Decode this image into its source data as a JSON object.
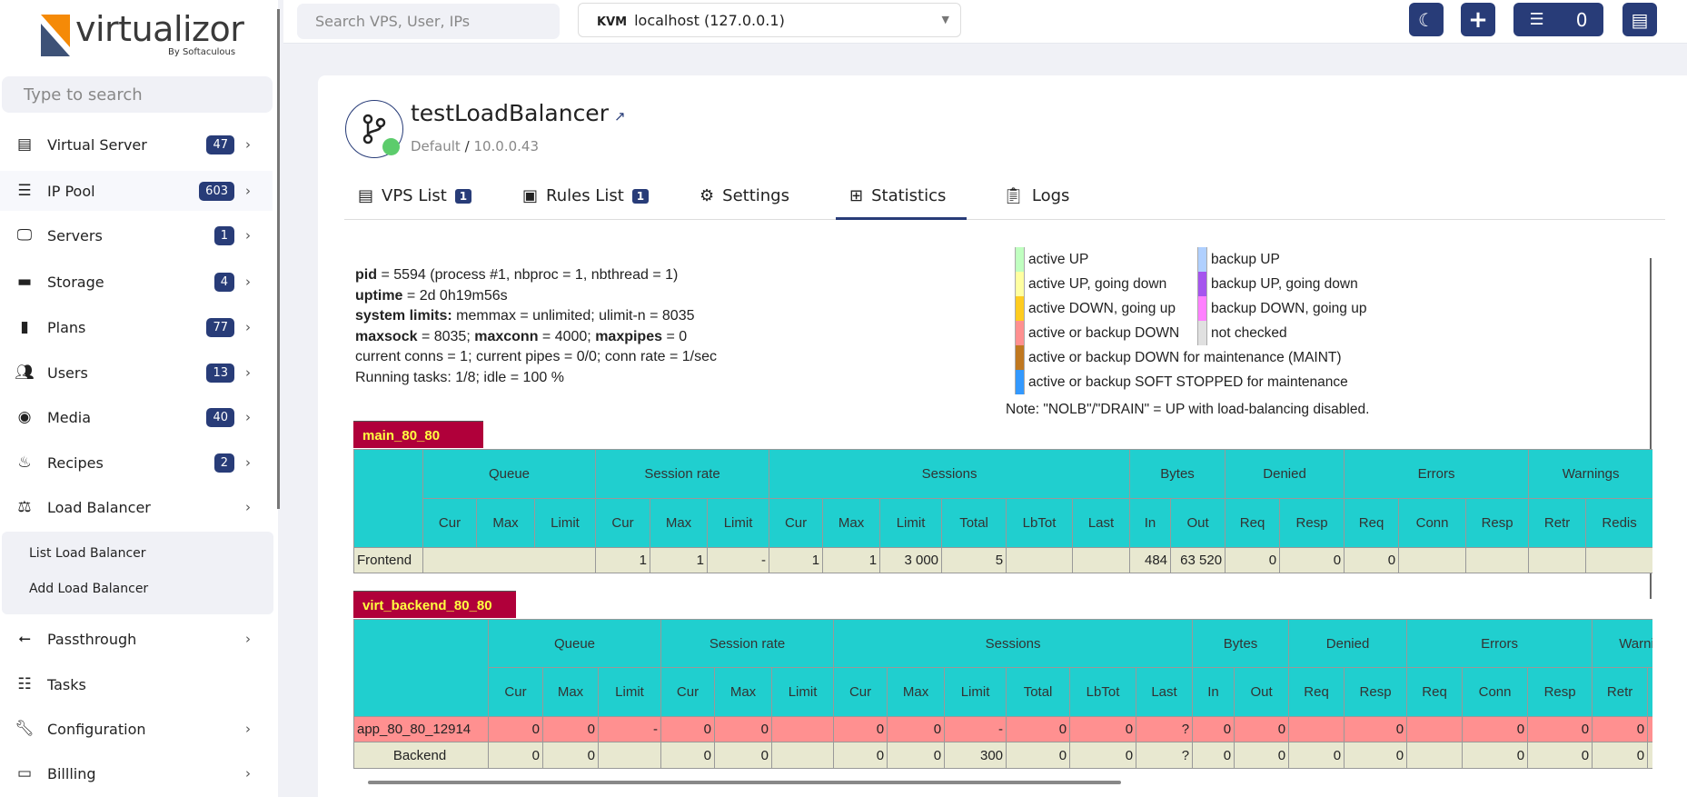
{
  "app": {
    "logo_text": "virtualizor",
    "logo_sub": "By Softaculous"
  },
  "sidebar": {
    "search_placeholder": "Type to search",
    "items": [
      {
        "label": "Virtual Server",
        "badge": "47",
        "icon": "server-icon"
      },
      {
        "label": "IP Pool",
        "badge": "603",
        "icon": "network-icon"
      },
      {
        "label": "Servers",
        "badge": "1",
        "icon": "desktop-icon"
      },
      {
        "label": "Storage",
        "badge": "4",
        "icon": "hdd-icon"
      },
      {
        "label": "Plans",
        "badge": "77",
        "icon": "clipboard-icon"
      },
      {
        "label": "Users",
        "badge": "13",
        "icon": "users-icon"
      },
      {
        "label": "Media",
        "badge": "40",
        "icon": "disc-icon"
      },
      {
        "label": "Recipes",
        "badge": "2",
        "icon": "recipe-icon"
      },
      {
        "label": "Load Balancer",
        "badge": "",
        "icon": "balance-scale-icon"
      },
      {
        "label": "Passthrough",
        "badge": "",
        "icon": "usb-icon"
      },
      {
        "label": "Tasks",
        "badge": "",
        "icon": "tasks-icon"
      },
      {
        "label": "Configuration",
        "badge": "",
        "icon": "wrench-icon"
      },
      {
        "label": "Billling",
        "badge": "",
        "icon": "credit-card-icon"
      }
    ],
    "submenu": [
      "List Load Balancer",
      "Add Load Balancer"
    ]
  },
  "topbar": {
    "search_placeholder": "Search VPS, User, IPs",
    "server_type": "KVM",
    "server": "localhost (127.0.0.1)",
    "tasks_count": "0"
  },
  "header": {
    "title": "testLoadBalancer",
    "group": "Default",
    "ip": "10.0.0.43",
    "status_color": "#5ccc6c"
  },
  "tabs": [
    {
      "label": "VPS List",
      "badge": "1"
    },
    {
      "label": "Rules List",
      "badge": "1"
    },
    {
      "label": "Settings"
    },
    {
      "label": "Statistics",
      "active": true
    },
    {
      "label": "Logs"
    }
  ],
  "info": [
    {
      "b": "pid",
      "t": " = 5594 (process #1, nbproc = 1, nbthread = 1)"
    },
    {
      "b": "uptime",
      "t": " = 2d 0h19m56s"
    },
    {
      "b": "system limits:",
      "t": " memmax = unlimited; ulimit-n = 8035"
    },
    {
      "b": "maxsock",
      "t": " = 8035; ",
      "b2": "maxconn",
      "t2": " = 4000; ",
      "b3": "maxpipes",
      "t3": " = 0"
    },
    {
      "t": "current conns = 1; current pipes = 0/0; conn rate = 1/sec"
    },
    {
      "t": "Running tasks: 1/8; idle = 100 %"
    }
  ],
  "legend": {
    "left": [
      {
        "label": "active UP",
        "color": "#c0ffc0"
      },
      {
        "label": "active UP, going down",
        "color": "#ffffa0"
      },
      {
        "label": "active DOWN, going up",
        "color": "#ffcc20"
      },
      {
        "label": "active or backup DOWN",
        "color": "#ff9090"
      },
      {
        "label": "active or backup DOWN for maintenance (MAINT)",
        "color": "#c07820"
      },
      {
        "label": "active or backup SOFT STOPPED for maintenance",
        "color": "#3399ff"
      }
    ],
    "right": [
      {
        "label": "backup UP",
        "color": "#b0d0ff"
      },
      {
        "label": "backup UP, going down",
        "color": "#a555ee"
      },
      {
        "label": "backup DOWN, going up",
        "color": "#ff80ff"
      },
      {
        "label": "not checked",
        "color": "#e0e0e0"
      }
    ],
    "note": "Note: \"NOLB\"/\"DRAIN\" = UP with load-balancing disabled."
  },
  "groups": [
    "Queue",
    "Session rate",
    "Sessions",
    "Bytes",
    "Denied",
    "Errors",
    "Warnings"
  ],
  "group_spans": [
    3,
    3,
    6,
    2,
    2,
    3,
    2
  ],
  "subheaders": [
    "Cur",
    "Max",
    "Limit",
    "Cur",
    "Max",
    "Limit",
    "Cur",
    "Max",
    "Limit",
    "Total",
    "LbTot",
    "Last",
    "In",
    "Out",
    "Req",
    "Resp",
    "Req",
    "Conn",
    "Resp",
    "Retr",
    "Redis"
  ],
  "proxies": [
    {
      "name": "main_80_80",
      "rows": [
        {
          "cells": [
            "Frontend",
            "",
            "1",
            "1",
            "-",
            "1",
            "1",
            "3 000",
            "5",
            "",
            "",
            "484",
            "63 520",
            "0",
            "0",
            "0",
            "",
            "",
            "",
            "",
            ""
          ],
          "queue_merged": true
        }
      ]
    },
    {
      "name": "virt_backend_80_80",
      "rows": [
        {
          "status": "down",
          "cells": [
            "app_80_80_12914",
            "0",
            "0",
            "-",
            "0",
            "0",
            "",
            "0",
            "0",
            "-",
            "0",
            "0",
            "?",
            "0",
            "0",
            "",
            "0",
            "",
            "0",
            "0",
            "0",
            ""
          ]
        },
        {
          "cells": [
            "Backend",
            "0",
            "0",
            "",
            "0",
            "0",
            "",
            "0",
            "0",
            "300",
            "0",
            "0",
            "?",
            "0",
            "0",
            "0",
            "0",
            "",
            "0",
            "0",
            "0",
            ""
          ]
        }
      ]
    }
  ]
}
